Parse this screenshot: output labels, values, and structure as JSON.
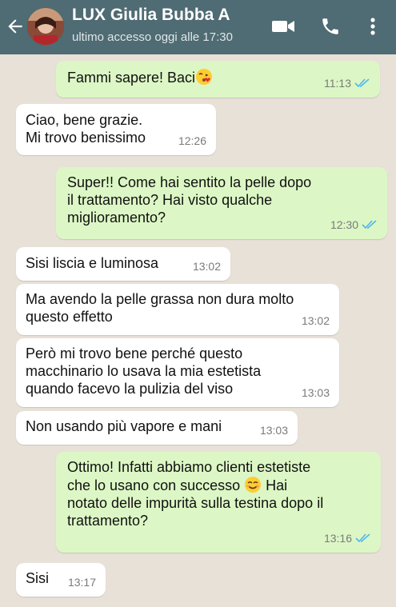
{
  "header": {
    "contact_name": "LUX Giulia Bubba A",
    "status": "ultimo accesso oggi alle 17:30"
  },
  "messages": [
    {
      "direction": "out",
      "text": "Fammi sapere! Baci",
      "emoji": "kissing-face-emoji",
      "time": "11:13",
      "read": true
    },
    {
      "direction": "in",
      "text": "Ciao, bene grazie.\nMi trovo benissimo",
      "time": "12:26"
    },
    {
      "direction": "out",
      "text": "Super!! Come hai sentito la pelle dopo\nil trattamento? Hai visto qualche\nmiglioramento?",
      "time": "12:30",
      "read": true
    },
    {
      "direction": "in",
      "text": "Sisi liscia e luminosa",
      "time": "13:02"
    },
    {
      "direction": "in",
      "text": "Ma avendo la pelle grassa non dura molto\nquesto effetto",
      "time": "13:02"
    },
    {
      "direction": "in",
      "text": "Però mi trovo bene perché questo\nmacchinario lo usava la mia estetista\nquando facevo la pulizia del viso",
      "time": "13:03"
    },
    {
      "direction": "in",
      "text": "Non usando più vapore e mani",
      "time": "13:03"
    },
    {
      "direction": "out",
      "text_a": "Ottimo! Infatti abbiamo clienti estetiste\nche lo usano con successo ",
      "emoji": "smiling-face-emoji",
      "text_b": " Hai\nnotato delle impurità sulla testina dopo il\ntrattamento?",
      "time": "13:16",
      "read": true
    },
    {
      "direction": "in",
      "text": "Sisi",
      "time": "13:17"
    }
  ],
  "colors": {
    "header_bg": "#4f6b73",
    "chat_bg": "#e8e1d8",
    "incoming_bubble": "#ffffff",
    "outgoing_bubble": "#dcf7c5",
    "read_check": "#4fb6ec"
  }
}
